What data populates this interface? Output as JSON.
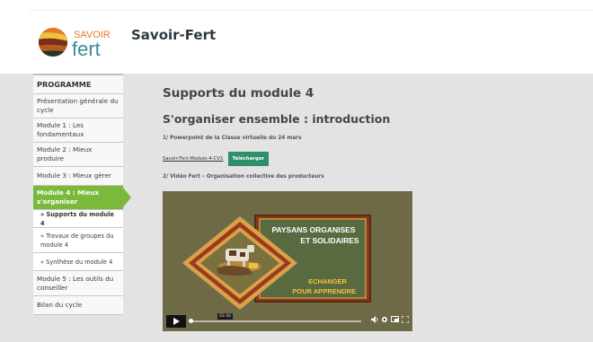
{
  "brand": {
    "logo_word1": "SAVOIR",
    "logo_word2": "fert",
    "site_title": "Savoir-Fert",
    "colors": {
      "orange": "#e8772a",
      "dark_green": "#233b22",
      "yellow": "#f0c23c",
      "brown": "#8a4a1f",
      "teal": "#3a8a9c"
    }
  },
  "sidebar": {
    "heading": "PROGRAMME",
    "items": [
      {
        "label": "Présentation générale du cycle"
      },
      {
        "label": "Module 1 : Les fondamentaux"
      },
      {
        "label": "Module 2 : Mieux produire"
      },
      {
        "label": "Module 3 : Mieux gérer"
      },
      {
        "label": "Module 4 : Mieux s'organiser",
        "active": true
      },
      {
        "label": "» Supports du module 4",
        "sub": true,
        "current": true
      },
      {
        "label": "» Travaux de groupes du module 4",
        "sub": true
      },
      {
        "label": "» Synthèse du module 4",
        "sub": true
      },
      {
        "label": "Module 5 : Les outils du conseiller"
      },
      {
        "label": "Bilan du cycle"
      }
    ],
    "active_color": "#7bb93c"
  },
  "main": {
    "page_heading": "Supports du module 4",
    "section_heading": "S'organiser ensemble :  introduction",
    "paragraph1": "1/ Powerpoint de la Classe virtuelle du 24 mars",
    "file_link": "Savoir-Fert-Module-4-CV1",
    "download_button": "Télécharger",
    "download_button_color": "#2e8f68",
    "paragraph2": "2/ Vidéo Fert – Organisation collective des producteurs"
  },
  "video": {
    "title_line1": "PAYSANS ORGANISES",
    "title_line2": "ET SOLIDAIRES",
    "subtitle_line1": "ECHANGER",
    "subtitle_line2": "POUR APPRENDRE",
    "time": "02:30",
    "progress": 0.0,
    "icons": [
      "play-icon",
      "volume-icon",
      "settings-icon",
      "pip-icon",
      "fullscreen-icon"
    ]
  }
}
